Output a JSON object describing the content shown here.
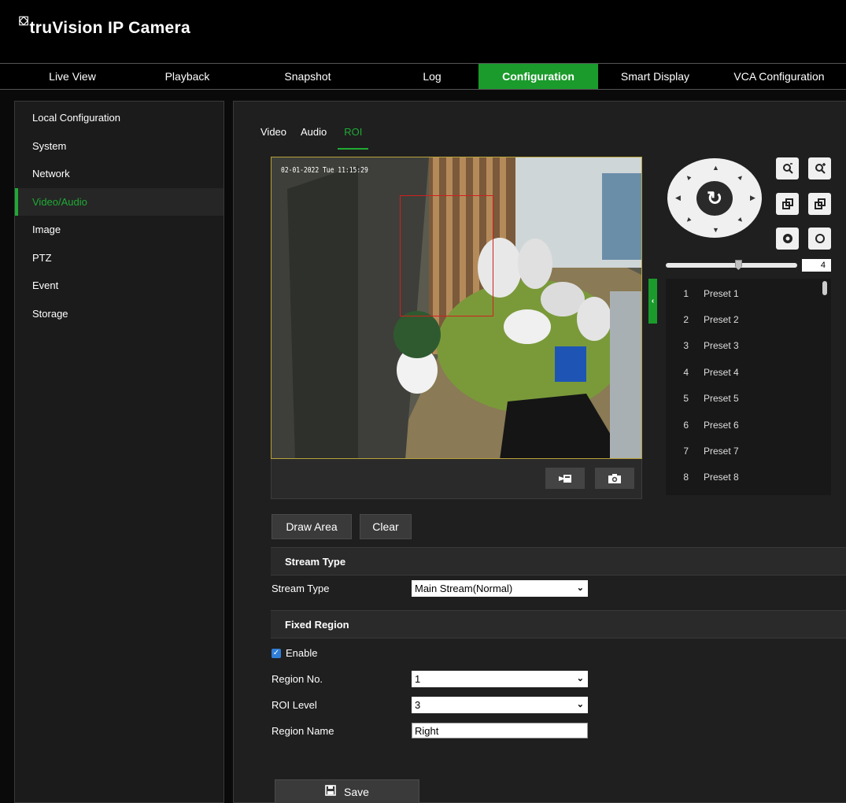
{
  "app": {
    "logo_mark": "⛋",
    "title": "truVision IP Camera"
  },
  "topnav": [
    {
      "label": "Live View",
      "active": false
    },
    {
      "label": "Playback",
      "active": false
    },
    {
      "label": "Snapshot",
      "active": false
    },
    {
      "label": "Log",
      "active": false
    },
    {
      "label": "Configuration",
      "active": true
    },
    {
      "label": "Smart Display",
      "active": false
    },
    {
      "label": "VCA Configuration",
      "active": false
    }
  ],
  "sidebar": {
    "items": [
      {
        "label": "Local Configuration",
        "active": false
      },
      {
        "label": "System",
        "active": false
      },
      {
        "label": "Network",
        "active": false
      },
      {
        "label": "Video/Audio",
        "active": true
      },
      {
        "label": "Image",
        "active": false
      },
      {
        "label": "PTZ",
        "active": false
      },
      {
        "label": "Event",
        "active": false
      },
      {
        "label": "Storage",
        "active": false
      }
    ]
  },
  "tabs": [
    {
      "label": "Video",
      "active": false
    },
    {
      "label": "Audio",
      "active": false
    },
    {
      "label": "ROI",
      "active": true
    }
  ],
  "video": {
    "osd_timestamp": "02-01-2022 Tue 11:15:29",
    "record_icon": "record-video-icon",
    "snapshot_icon": "camera-icon"
  },
  "ptz": {
    "center_symbol": "↻",
    "speed_value": "4",
    "speed_level": 0.55,
    "collapse_symbol": "‹",
    "buttons": [
      "zoom-out-icon",
      "zoom-in-icon",
      "focus-near-icon",
      "focus-far-icon",
      "iris-close-icon",
      "iris-open-icon"
    ]
  },
  "presets": [
    {
      "num": "1",
      "name": "Preset 1"
    },
    {
      "num": "2",
      "name": "Preset 2"
    },
    {
      "num": "3",
      "name": "Preset 3"
    },
    {
      "num": "4",
      "name": "Preset 4"
    },
    {
      "num": "5",
      "name": "Preset 5"
    },
    {
      "num": "6",
      "name": "Preset 6"
    },
    {
      "num": "7",
      "name": "Preset 7"
    },
    {
      "num": "8",
      "name": "Preset 8"
    }
  ],
  "actions": {
    "draw_area": "Draw Area",
    "clear": "Clear",
    "save": "Save"
  },
  "stream_section": {
    "heading": "Stream Type",
    "label": "Stream Type",
    "value": "Main Stream(Normal)"
  },
  "fixed_region": {
    "heading": "Fixed Region",
    "enable_label": "Enable",
    "enable_checked": true,
    "region_no_label": "Region No.",
    "region_no_value": "1",
    "roi_level_label": "ROI Level",
    "roi_level_value": "3",
    "region_name_label": "Region Name",
    "region_name_value": "Right"
  },
  "colors": {
    "accent": "#1a9b2b",
    "roi_box": "#d02020",
    "checkbox": "#2f7ed8"
  }
}
